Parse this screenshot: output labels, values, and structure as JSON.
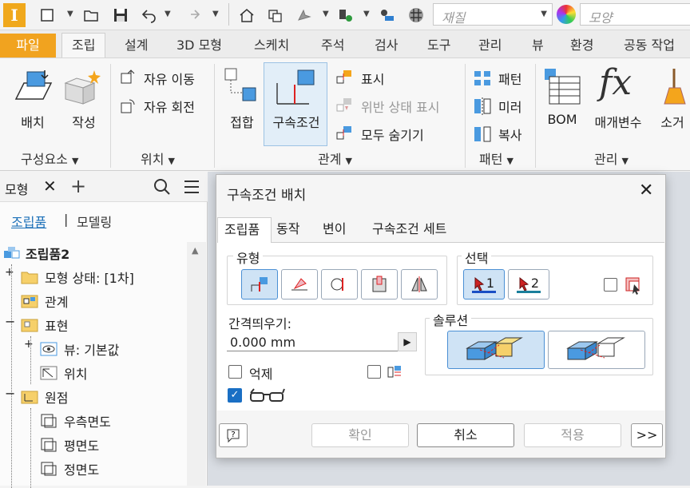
{
  "qat": {
    "style_placeholder": "재질",
    "appearance_placeholder": "모양",
    "logo": "I"
  },
  "tabs": {
    "file": "파일",
    "items": [
      "조립",
      "설계",
      "3D 모형",
      "스케치",
      "주석",
      "검사",
      "도구",
      "관리",
      "뷰",
      "환경",
      "공동 작업"
    ],
    "active": "조립"
  },
  "ribbon": {
    "component": {
      "place": "배치",
      "create": "작성",
      "group": "구성요소"
    },
    "position": {
      "free_move": "자유 이동",
      "free_rotate": "자유 회전",
      "group": "위치"
    },
    "relationships": {
      "joint": "접합",
      "constrain": "구속조건",
      "show": "표시",
      "show_sick": "위반 상태 표시",
      "hide_all": "모두 숨기기",
      "group": "관계"
    },
    "pattern": {
      "pattern": "패턴",
      "mirror": "미러",
      "copy": "복사",
      "group": "패턴"
    },
    "manage": {
      "bom": "BOM",
      "params": "매개변수",
      "purge": "소거",
      "group": "관리"
    }
  },
  "model_panel": {
    "tab": "모형",
    "assembly_link": "조립품",
    "modeling_link": "모델링",
    "tree": [
      {
        "label": "조립품2",
        "bold": true
      },
      {
        "label": "모형 상태: [1차]"
      },
      {
        "label": "관계"
      },
      {
        "label": "표현"
      },
      {
        "label": "뷰: 기본값"
      },
      {
        "label": "위치"
      },
      {
        "label": "원점"
      },
      {
        "label": "우측면도"
      },
      {
        "label": "평면도"
      },
      {
        "label": "정면도"
      }
    ]
  },
  "dialog": {
    "title": "구속조건 배치",
    "tabs": [
      "조립품",
      "동작",
      "변이",
      "구속조건 세트"
    ],
    "type_label": "유형",
    "selection_label": "선택",
    "sel1": "1",
    "sel2": "2",
    "offset_label": "간격띄우기:",
    "offset_value": "0.000 mm",
    "solution_label": "솔루션",
    "suppress_label": "억제",
    "ok": "확인",
    "cancel": "취소",
    "apply": "적용",
    "more": ">>"
  }
}
